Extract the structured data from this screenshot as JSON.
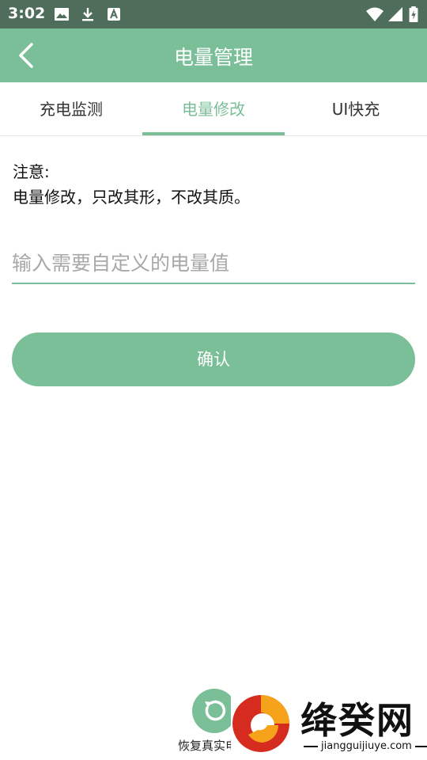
{
  "status_bar": {
    "time": "3:02",
    "icons": [
      "image-icon",
      "download-icon",
      "text-a-icon",
      "wifi-icon",
      "signal-icon",
      "battery-charging-icon"
    ]
  },
  "app_bar": {
    "title": "电量管理",
    "back_icon": "back-arrow-icon"
  },
  "tabs": [
    {
      "label": "充电监测",
      "active": false
    },
    {
      "label": "电量修改",
      "active": true
    },
    {
      "label": "UI快充",
      "active": false
    }
  ],
  "notice": {
    "title": "注意:",
    "body": "电量修改，只改其形，不改其质。"
  },
  "battery_input": {
    "value": "",
    "placeholder": "输入需要自定义的电量值"
  },
  "confirm_button": {
    "label": "确认"
  },
  "restore": {
    "label": "恢复真实电量"
  },
  "watermark": {
    "title": "绛癸网",
    "url": "jiangguijiuye.com"
  },
  "colors": {
    "accent": "#7bbf99",
    "status_bar": "#4e6e5b"
  }
}
